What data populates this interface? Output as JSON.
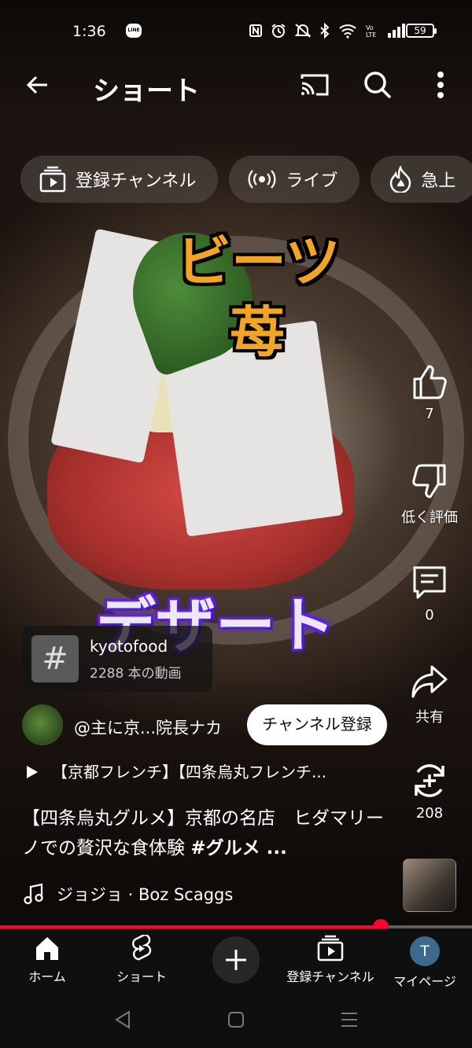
{
  "status_bar": {
    "time": "1:36",
    "line_badge": "LINE",
    "icons": [
      "nfc-icon",
      "alarm-icon",
      "mute-icon",
      "bluetooth-icon",
      "wifi-icon",
      "volte-icon",
      "signal-icon"
    ],
    "battery": "59"
  },
  "header": {
    "title": "ショート"
  },
  "chips": [
    {
      "label": "登録チャンネル",
      "icon": "subscriptions-icon"
    },
    {
      "label": "ライブ",
      "icon": "live-icon"
    },
    {
      "label": "急上",
      "icon": "trending-icon"
    }
  ],
  "video_captions": {
    "line1": "ビーツ",
    "line2": "苺",
    "line3": "デザート"
  },
  "actions": {
    "like_count": "7",
    "dislike_label": "低く評価",
    "comment_count": "0",
    "share_label": "共有",
    "remix_count": "208"
  },
  "hashtag_card": {
    "icon": "#",
    "name": "kyotofood",
    "count": "2288 本の動画"
  },
  "channel": {
    "name": "@主に京...院長ナカ",
    "subscribe_label": "チャンネル登録"
  },
  "playlist": {
    "text": "【京都フレンチ】【四条烏丸フレンチ..."
  },
  "description": {
    "text": "【四条烏丸グルメ】京都の名店　ヒダマリーノでの贅沢な食体験 ",
    "tag": "#グルメ ..."
  },
  "music": {
    "text": "ジョジョ · Boz Scaggs"
  },
  "progress": {
    "fraction": 0.807
  },
  "bottom_nav": {
    "home": "ホーム",
    "shorts": "ショート",
    "subscriptions": "登録チャンネル",
    "profile": "マイページ",
    "profile_initial": "T"
  },
  "colors": {
    "accent_red": "#ff0033",
    "caption_orange": "#f2a424",
    "caption_purple": "#5a1ee0"
  }
}
